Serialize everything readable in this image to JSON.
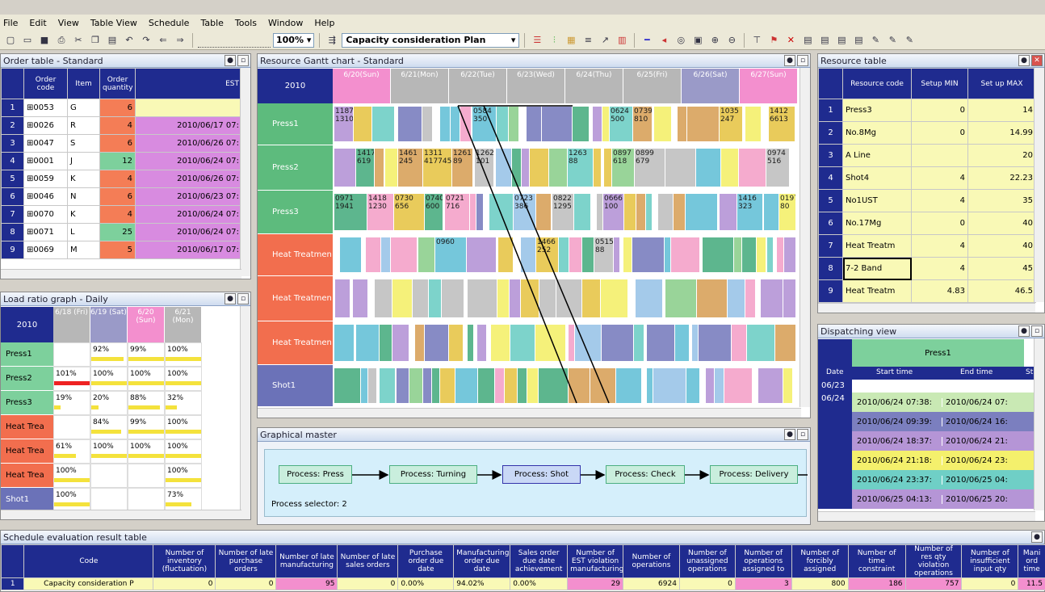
{
  "menu": [
    "File",
    "Edit",
    "View",
    "Table View",
    "Schedule",
    "Table",
    "Tools",
    "Window",
    "Help"
  ],
  "toolbar": {
    "zoom": "100%",
    "plan": "Capacity consideration Plan"
  },
  "order_table": {
    "title": "Order table - Standard",
    "columns": [
      "Order code",
      "Item",
      "Order quantity",
      "EST"
    ],
    "rows": [
      {
        "n": "1",
        "code": "⊞0053",
        "item": "G",
        "qty": "6",
        "est": "",
        "color": "#f9f9b6"
      },
      {
        "n": "2",
        "code": "⊞0026",
        "item": "R",
        "qty": "4",
        "est": "2010/06/17 07:",
        "color": "#d88be0"
      },
      {
        "n": "3",
        "code": "⊞0047",
        "item": "S",
        "qty": "6",
        "est": "2010/06/26 07:",
        "color": "#d88be0"
      },
      {
        "n": "4",
        "code": "⊞0001",
        "item": "J",
        "qty": "12",
        "est": "2010/06/24 07:",
        "color": "#d88be0"
      },
      {
        "n": "5",
        "code": "⊞0059",
        "item": "K",
        "qty": "4",
        "est": "2010/06/26 07:",
        "color": "#d88be0"
      },
      {
        "n": "6",
        "code": "⊞0046",
        "item": "N",
        "qty": "6",
        "est": "2010/06/23 07:",
        "color": "#d88be0"
      },
      {
        "n": "7",
        "code": "⊞0070",
        "item": "K",
        "qty": "4",
        "est": "2010/06/24 07:",
        "color": "#d88be0"
      },
      {
        "n": "8",
        "code": "⊞0071",
        "item": "L",
        "qty": "25",
        "est": "2010/06/24 07:",
        "color": "#d88be0"
      },
      {
        "n": "9",
        "code": "⊞0069",
        "item": "M",
        "qty": "5",
        "est": "2010/06/17 07:",
        "color": "#d88be0"
      }
    ]
  },
  "load_ratio": {
    "title": "Load ratio graph - Daily",
    "year": "2010",
    "days": [
      "6/18 (Fri)",
      "6/19 (Sat)",
      "6/20 (Sun)",
      "6/21 (Mon)"
    ],
    "rows": [
      {
        "name": "Press1",
        "color": "#7dd09c",
        "vals": [
          "",
          "92%",
          "99%",
          "100%"
        ]
      },
      {
        "name": "Press2",
        "color": "#7dd09c",
        "vals": [
          "101%",
          "100%",
          "100%",
          "100%"
        ]
      },
      {
        "name": "Press3",
        "color": "#7dd09c",
        "vals": [
          "19%",
          "20%",
          "88%",
          "32%"
        ]
      },
      {
        "name": "Heat Trea",
        "color": "#f26e4e",
        "vals": [
          "",
          "84%",
          "99%",
          "100%"
        ]
      },
      {
        "name": "Heat Trea",
        "color": "#f26e4e",
        "vals": [
          "61%",
          "100%",
          "100%",
          "100%"
        ]
      },
      {
        "name": "Heat Trea",
        "color": "#f26e4e",
        "vals": [
          "100%",
          "",
          "",
          "100%"
        ]
      },
      {
        "name": "Shot1",
        "color": "#6b72b8",
        "vals": [
          "100%",
          "",
          "",
          "73%"
        ]
      }
    ]
  },
  "gantt": {
    "title": "Resource Gantt chart - Standard",
    "year": "2010",
    "dates": [
      "6/20(Sun)",
      "6/21(Mon)",
      "6/22(Tue)",
      "6/23(Wed)",
      "6/24(Thu)",
      "6/25(Fri)",
      "6/26(Sat)",
      "6/27(Sun)"
    ],
    "lanes": [
      {
        "name": "Press1",
        "color": "#5dbb7d"
      },
      {
        "name": "Press2",
        "color": "#5dbb7d"
      },
      {
        "name": "Press3",
        "color": "#5dbb7d"
      },
      {
        "name": "Heat Treatmen",
        "color": "#f26e4e"
      },
      {
        "name": "Heat Treatmen",
        "color": "#f26e4e"
      },
      {
        "name": "Heat Treatmen",
        "color": "#f26e4e"
      },
      {
        "name": "Shot1",
        "color": "#6b72b8"
      }
    ],
    "labels": [
      "1187 1310",
      "0584 350",
      "0624 500",
      "0739 810",
      "1035 247",
      "1412 6613",
      "1417 619",
      "1461 245",
      "1311 4177458",
      "1261 89",
      "1262 101",
      "1263 88",
      "0897 618",
      "0899 679",
      "0974 516",
      "0971 1941",
      "1418 1230",
      "0730 656",
      "0740 600",
      "0721 716",
      "0723 386",
      "0822 1295",
      "0666 100",
      "1416 323",
      "0197 80",
      "0960",
      "1466 252",
      "0515 88"
    ]
  },
  "resource_table": {
    "title": "Resource table",
    "columns": [
      "Resource code",
      "Setup MIN",
      "Set up MAX"
    ],
    "rows": [
      {
        "n": "1",
        "code": "Press3",
        "min": "0",
        "max": "14"
      },
      {
        "n": "2",
        "code": "No.8Mg",
        "min": "0",
        "max": "14.99"
      },
      {
        "n": "3",
        "code": "A Line",
        "min": "",
        "max": "20"
      },
      {
        "n": "4",
        "code": "Shot4",
        "min": "4",
        "max": "22.23"
      },
      {
        "n": "5",
        "code": "No1UST",
        "min": "4",
        "max": "35"
      },
      {
        "n": "6",
        "code": "No.17Mg",
        "min": "0",
        "max": "40"
      },
      {
        "n": "7",
        "code": "Heat Treatm",
        "min": "4",
        "max": "40"
      },
      {
        "n": "8",
        "code": "7-2 Band",
        "min": "4",
        "max": "45"
      },
      {
        "n": "9",
        "code": "Heat Treatm",
        "min": "4.83",
        "max": "46.5"
      }
    ]
  },
  "dispatch": {
    "title": "Dispatching view",
    "resource": "Press1",
    "cols": [
      "Date",
      "Start time",
      "End time",
      "St"
    ],
    "dates": [
      "06/23",
      "06/24"
    ],
    "rows": [
      {
        "start": "2010/06/24 07:38:",
        "end": "2010/06/24 07:",
        "color": "#c9e9b4"
      },
      {
        "start": "2010/06/24 09:39:",
        "end": "2010/06/24 16:",
        "color": "#7b7fbf"
      },
      {
        "start": "2010/06/24 18:37:",
        "end": "2010/06/24 21:",
        "color": "#b595d6"
      },
      {
        "start": "2010/06/24 21:18:",
        "end": "2010/06/24 23:",
        "color": "#f4f06c"
      },
      {
        "start": "2010/06/24 23:37:",
        "end": "2010/06/25 04:",
        "color": "#6fcfc6"
      },
      {
        "start": "2010/06/25 04:13:",
        "end": "2010/06/25 20:",
        "color": "#b595d6"
      }
    ]
  },
  "graphical_master": {
    "title": "Graphical master",
    "processes": [
      "Process: Press",
      "Process: Turning",
      "Process: Shot",
      "Process: Check",
      "Process: Delivery"
    ],
    "selector": "Process selector: 2"
  },
  "evaluation": {
    "title": "Schedule evaluation result table",
    "columns": [
      "Code",
      "Number of inventory (fluctuation)",
      "Number of late purchase orders",
      "Number of late manufacturing",
      "Number of late sales orders",
      "Purchase order due date",
      "Manufacturing order due date",
      "Sales order due date achievement",
      "Number of EST violation manufacturing",
      "Number of operations",
      "Number of unassigned operations",
      "Number of operations assigned to",
      "Number of forcibly assigned",
      "Number of time constraint",
      "Number of res qty violation operations",
      "Number of insufficient input qty",
      "Mani ord time"
    ],
    "row": [
      "Capacity consideration P",
      "0",
      "0",
      "95",
      "0",
      "0.00%",
      "94.02%",
      "0.00%",
      "29",
      "6924",
      "0",
      "3",
      "800",
      "186",
      "757",
      "0",
      "11.5"
    ]
  }
}
